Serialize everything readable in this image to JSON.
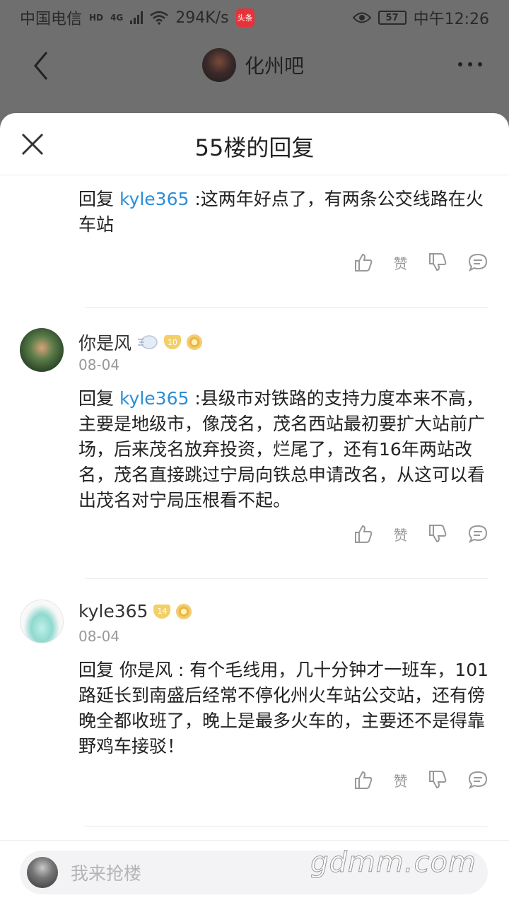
{
  "status_bar": {
    "carrier": "中国电信",
    "hd": "HD",
    "network": "4G",
    "speed": "294K/s",
    "app_badge": "头条",
    "battery": "57",
    "time": "中午12:26"
  },
  "nav": {
    "forum_name": "化州吧"
  },
  "sheet": {
    "title": "55楼的回复"
  },
  "replies": [
    {
      "reply_prefix": "回复 ",
      "mention": "kyle365",
      "text": " :这两年好点了，有两条公交线路在火车站",
      "like_label": "赞"
    },
    {
      "username": "你是风",
      "level": "10",
      "date": "08-04",
      "reply_prefix": "回复 ",
      "mention": "kyle365",
      "text": " :县级市对铁路的支持力度本来不高，主要是地级市，像茂名，茂名西站最初要扩大站前广场，后来茂名放弃投资，烂尾了，还有16年两站改名，茂名直接跳过宁局向铁总申请改名，从这可以看出茂名对宁局压根看不起。",
      "like_label": "赞"
    },
    {
      "username": "kyle365",
      "level": "14",
      "date": "08-04",
      "reply_prefix": "回复 ",
      "mention": "你是风",
      "text": " : 有个毛线用，几十分钟才一班车，101路延长到南盛后经常不停化州火车站公交站，还有傍晚全都收班了，晚上是最多火车的，主要还不是得靠野鸡车接驳！",
      "like_label": "赞"
    }
  ],
  "composer": {
    "placeholder": "我来抢楼"
  },
  "watermark": "gdmm.com",
  "colors": {
    "mention": "#2b8ed8",
    "overlay": "#6f6f6f"
  }
}
